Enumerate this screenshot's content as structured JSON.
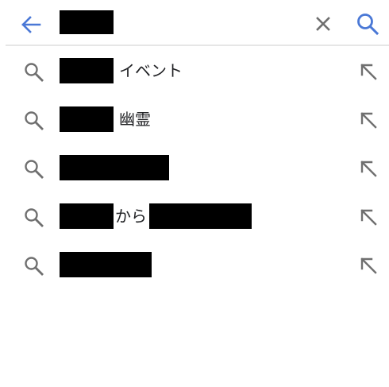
{
  "colors": {
    "accent": "#4a78d6",
    "icon_gray": "#6f6f6f",
    "divider": "#e6e6e6",
    "redaction": "#000000"
  },
  "search_bar": {
    "back_icon": "arrow-left-icon",
    "clear_icon": "close-icon",
    "submit_icon": "search-icon"
  },
  "suggestions": [
    {
      "icon": "search-icon",
      "fill_icon": "arrow-up-left-icon",
      "text_after": "イベント"
    },
    {
      "icon": "search-icon",
      "fill_icon": "arrow-up-left-icon",
      "text_after": "幽霊"
    },
    {
      "icon": "search-icon",
      "fill_icon": "arrow-up-left-icon",
      "text_after": ""
    },
    {
      "icon": "search-icon",
      "fill_icon": "arrow-up-left-icon",
      "text_middle": "から"
    },
    {
      "icon": "search-icon",
      "fill_icon": "arrow-up-left-icon",
      "text_after": ""
    }
  ]
}
